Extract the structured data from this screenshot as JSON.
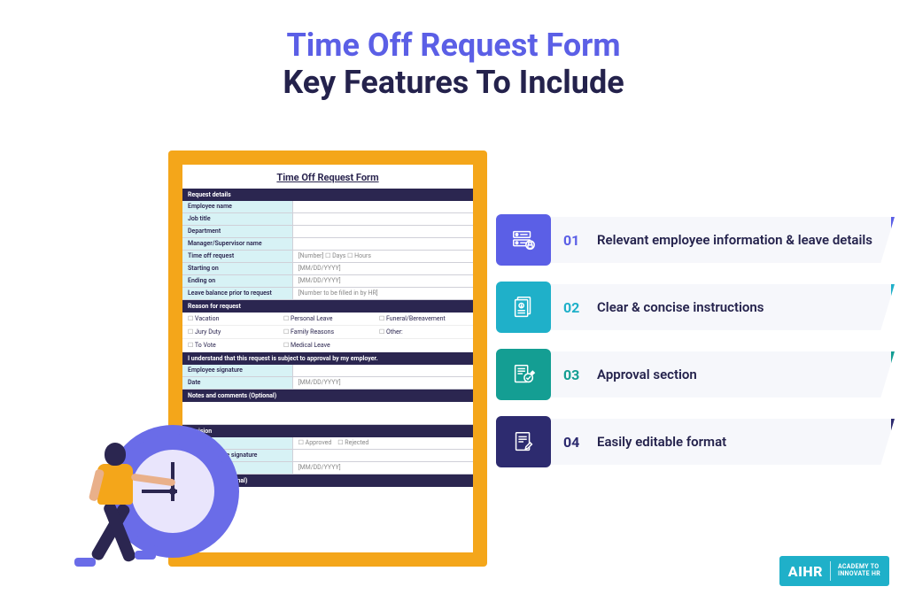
{
  "title": {
    "line1": "Time Off Request Form",
    "line2": "Key Features To Include"
  },
  "form": {
    "heading": "Time Off Request Form",
    "sections": {
      "request_details": "Request details",
      "reason": "Reason for request",
      "ack": "I understand that this request is subject to approval by my employer.",
      "notes": "Notes and comments (Optional)",
      "decision": "Decision",
      "comments2": "Comments (Optional)"
    },
    "fields": {
      "employee_name": "Employee name",
      "job_title": "Job title",
      "department": "Department",
      "manager": "Manager/Supervisor name",
      "time_off_request": "Time off request",
      "time_off_value": "[Number]            ☐  Days            ☐  Hours",
      "starting_on": "Starting on",
      "ending_on": "Ending on",
      "date_ph": "[MM/DD/YYYY]",
      "leave_balance": "Leave balance prior to request",
      "leave_balance_ph": "[Number to be filled in by HR]",
      "employee_signature": "Employee signature",
      "date": "Date",
      "rep_sig": "Representative signature"
    },
    "reasons": {
      "vacation": "Vacation",
      "personal": "Personal Leave",
      "funeral": "Funeral/Bereavement",
      "jury": "Jury Duty",
      "family": "Family Reasons",
      "other": "Other:",
      "vote": "To Vote",
      "medical": "Medical Leave"
    },
    "decision": {
      "approved": "Approved",
      "rejected": "Rejected"
    }
  },
  "features": [
    {
      "num": "01",
      "text": "Relevant employee information & leave details"
    },
    {
      "num": "02",
      "text": "Clear & concise instructions"
    },
    {
      "num": "03",
      "text": "Approval section"
    },
    {
      "num": "04",
      "text": "Easily editable format"
    }
  ],
  "logo": {
    "mark": "AIHR",
    "sub1": "ACADEMY TO",
    "sub2": "INNOVATE HR"
  }
}
